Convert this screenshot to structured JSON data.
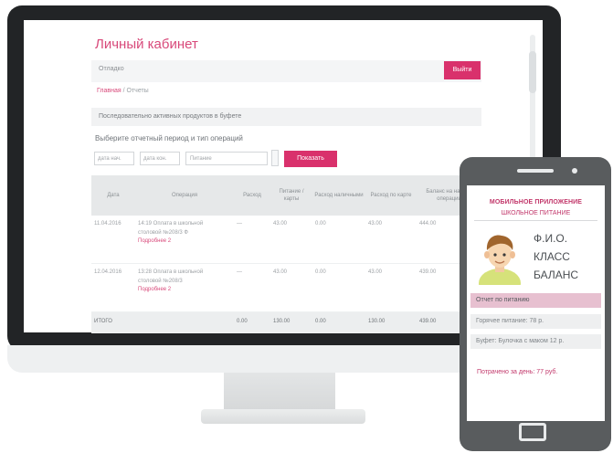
{
  "cabinet": {
    "title": "Личный кабинет",
    "user_label": "Отладко",
    "exit_label": "Выйти",
    "breadcrumb": {
      "home": "Главная",
      "separator": "/",
      "current": "Отчеты"
    },
    "notice": "Последовательно активных продуктов в буфете",
    "period_label": "Выберите отчетный период и тип операций",
    "date_from_placeholder": "дата нач.",
    "date_to_placeholder": "дата кон.",
    "type_placeholder": "Питание",
    "show_label": "Показать"
  },
  "table": {
    "headers": [
      "Дата",
      "Операция",
      "Расход",
      "Питание / карты",
      "Расход наличными",
      "Расход по карте",
      "Баланс на начало операции"
    ],
    "rows": [
      {
        "date": "11.04.2016",
        "op_line1": "14:19 Оплата в школьной",
        "op_line2": "столовой №208/3 Ф",
        "op_link": "Подробнее 2",
        "expense": "—",
        "card": "43.00",
        "cash": "0.00",
        "by_card": "43.00",
        "balance": "444.00"
      },
      {
        "date": "12.04.2016",
        "op_line1": "13:28 Оплата в школьной",
        "op_line2": "столовой №208/3",
        "op_link": "Подробнее 2",
        "expense": "—",
        "card": "43.00",
        "cash": "0.00",
        "by_card": "43.00",
        "balance": "439.00"
      }
    ],
    "total": {
      "label": "ИТОГО",
      "expense": "0.00",
      "card": "130.00",
      "cash": "0.00",
      "by_card": "130.00",
      "balance": "439.00"
    }
  },
  "phone": {
    "app_title": "МОБИЛЬНОЕ ПРИЛОЖЕНИЕ",
    "app_subtitle": "ШКОЛЬНОЕ ПИТАНИЕ",
    "name": "Ф.И.О.",
    "class_label": "КЛАСС",
    "balance_label": "БАЛАНС",
    "menu_active": "Отчет по питанию",
    "menu_items": [
      "Горячее питание: 78 р.",
      "Буфет: Булочка с маком 12 р."
    ],
    "spent_today": "Потрачено за день: 77 руб."
  },
  "colors": {
    "accent": "#d9316c",
    "bezel": "#222426",
    "phone_body": "#595c5e",
    "menu_highlight": "#e7c0d0"
  }
}
